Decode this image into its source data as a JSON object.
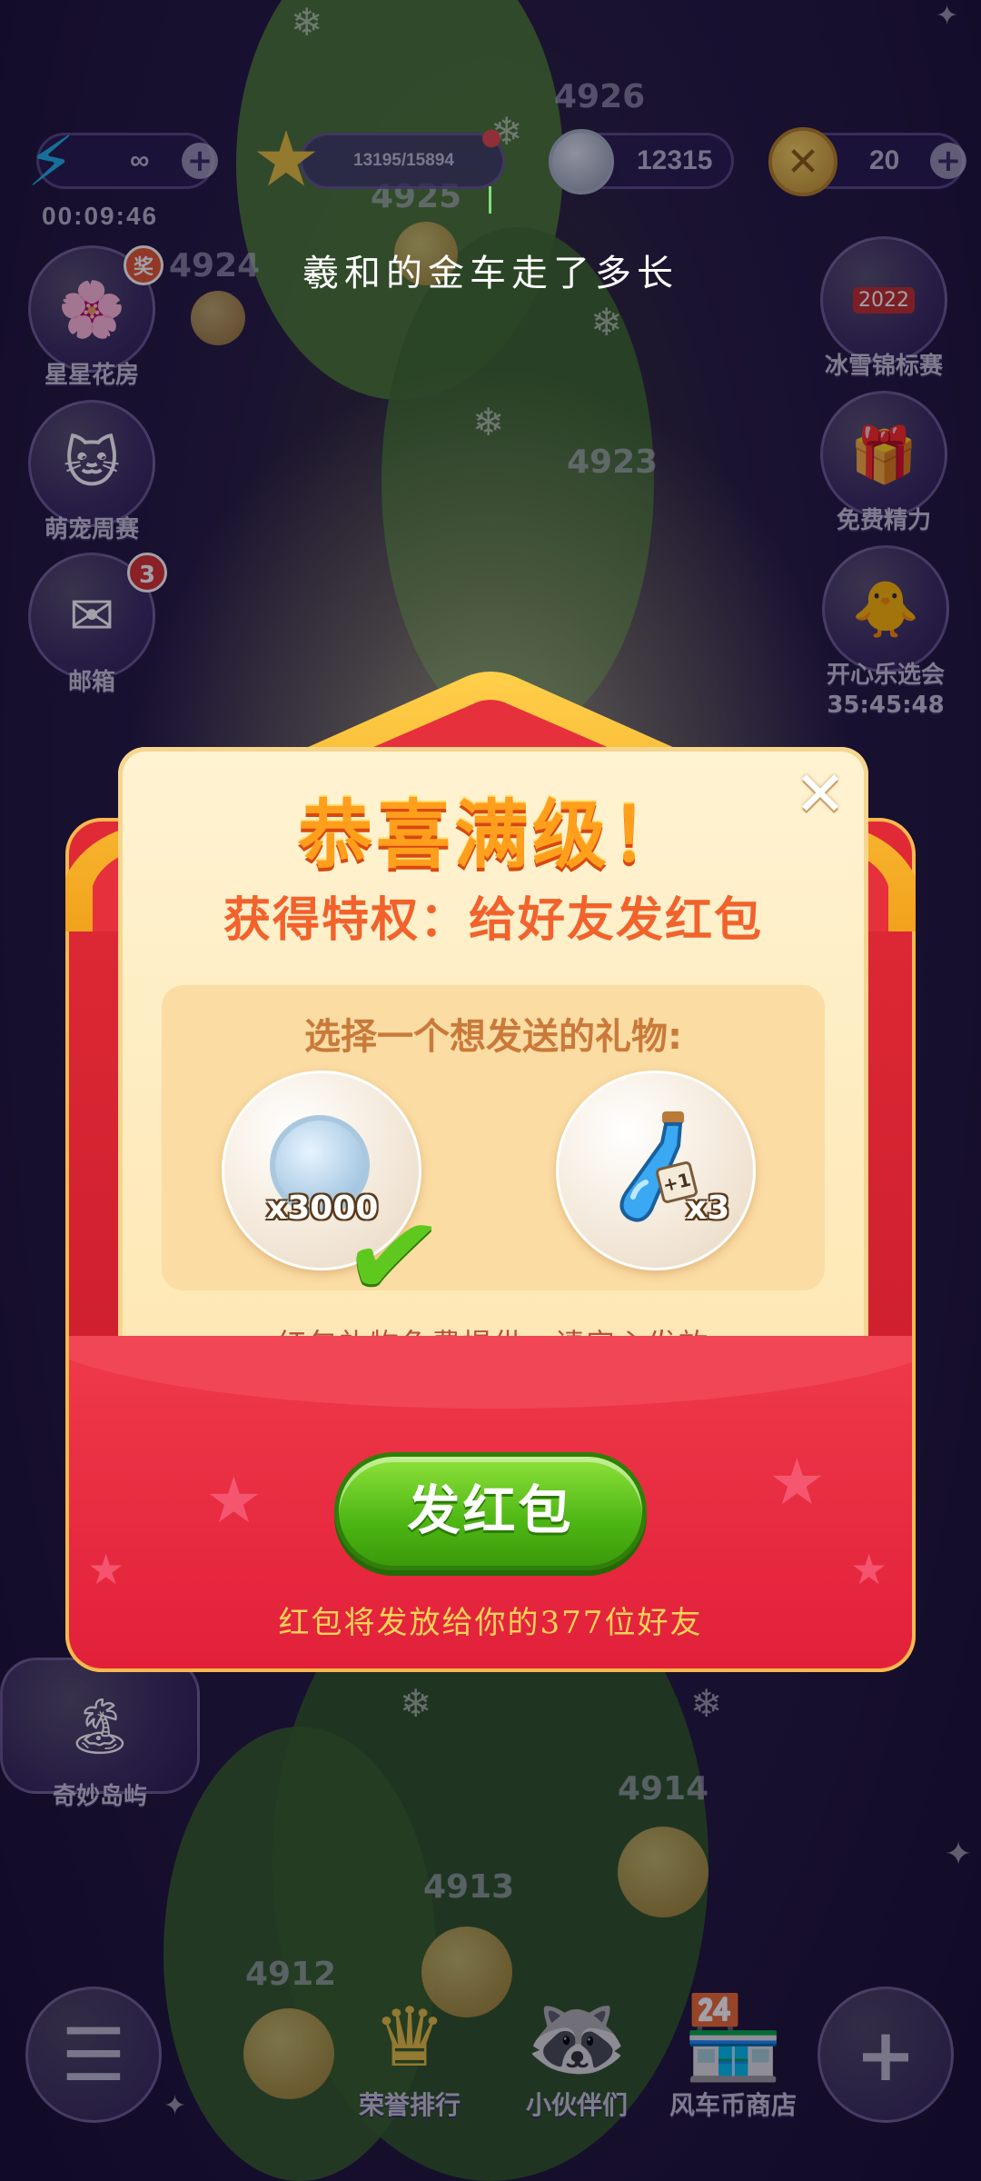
{
  "hud": {
    "lives_value": "∞",
    "lives_timer": "00:09:46",
    "stars_progress": "13195/15894",
    "coins_value": "12315",
    "gold_value": "20"
  },
  "map": {
    "levels": [
      "4926",
      "4925",
      "4924",
      "4923",
      "4914",
      "4913",
      "4912"
    ]
  },
  "left_menu": [
    {
      "label": "星星花房",
      "icon": "flower-house-icon",
      "badge": "奖"
    },
    {
      "label": "萌宠周赛",
      "icon": "pet-icon"
    },
    {
      "label": "邮箱",
      "icon": "mail-icon",
      "badge": "3"
    },
    {
      "label": "奇妙岛屿",
      "icon": "island-icon"
    }
  ],
  "right_menu": [
    {
      "label": "冰雪锦标赛",
      "icon": "trophy-icon",
      "tag": "2022"
    },
    {
      "label": "免费精力",
      "icon": "gift-icon"
    },
    {
      "label": "开心乐选会",
      "icon": "event-icon",
      "timer": "35:45:48"
    }
  ],
  "caption": "羲和的金车走了多长",
  "dialog": {
    "title": "恭喜满级！",
    "subtitle": "获得特权：给好友发红包",
    "close": "✕",
    "prompt": "选择一个想发送的礼物:",
    "gifts": [
      {
        "icon": "coin-icon",
        "quantity": "x3000",
        "selected": true
      },
      {
        "icon": "potion-icon",
        "quantity": "x3",
        "tag": "+1",
        "selected": false
      }
    ],
    "free_note": "红包礼物免费提供，请安心发放",
    "send_button": "发红包",
    "send_note": "红包将发放给你的377位好友"
  },
  "bottom_nav": [
    {
      "label": "",
      "icon": "menu-icon"
    },
    {
      "label": "荣誉排行",
      "icon": "crown-icon"
    },
    {
      "label": "小伙伴们",
      "icon": "friends-icon"
    },
    {
      "label": "风车币商店",
      "icon": "shop-icon"
    },
    {
      "label": "",
      "icon": "plus-icon"
    }
  ],
  "colors": {
    "accent_red": "#e2203a",
    "title_orange": "#ff9f1c",
    "button_green": "#4db614",
    "note_gold": "#ffd257"
  }
}
